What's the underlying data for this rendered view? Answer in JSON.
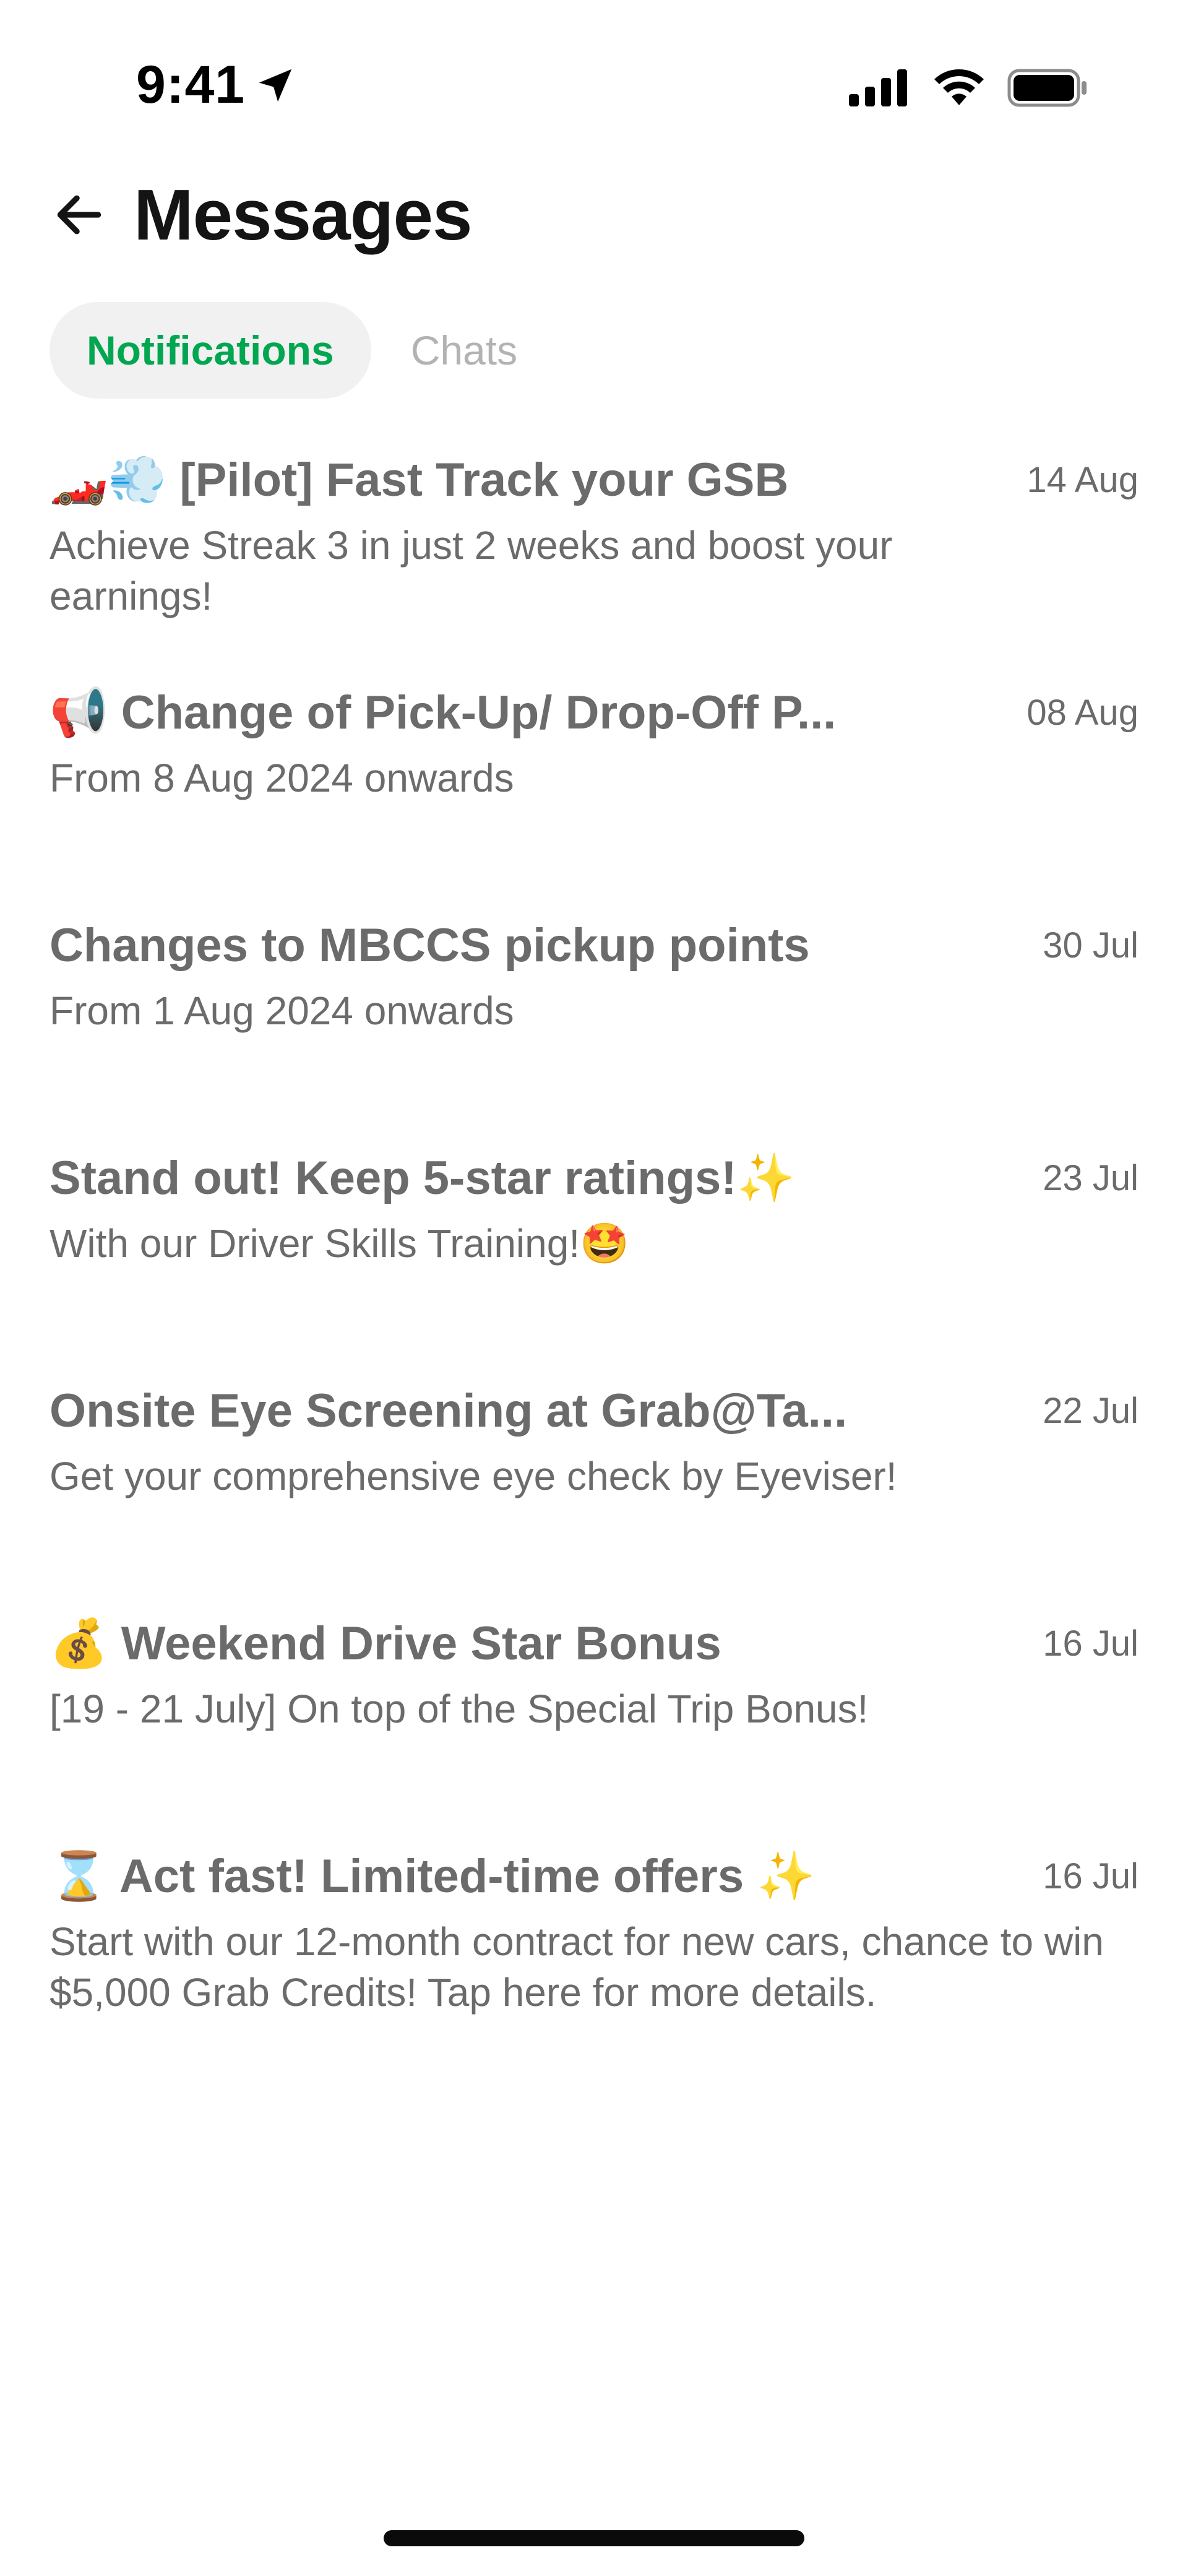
{
  "status_bar": {
    "time": "9:41"
  },
  "header": {
    "title": "Messages"
  },
  "tabs": [
    {
      "label": "Notifications",
      "active": true
    },
    {
      "label": "Chats",
      "active": false
    }
  ],
  "messages": [
    {
      "title": "🏎️💨 [Pilot] Fast Track your GSB",
      "date": "14 Aug",
      "subtitle": "Achieve Streak 3 in just 2 weeks and boost your earnings!"
    },
    {
      "title": "📢 Change of Pick-Up/ Drop-Off P...",
      "date": "08 Aug",
      "subtitle": "From 8 Aug 2024 onwards"
    },
    {
      "title": "Changes to MBCCS pickup points",
      "date": "30 Jul",
      "subtitle": "From 1 Aug 2024 onwards"
    },
    {
      "title": "Stand out! Keep 5-star ratings!✨",
      "date": "23 Jul",
      "subtitle": "With our Driver Skills Training!🤩"
    },
    {
      "title": "Onsite Eye Screening at Grab@Ta...",
      "date": "22 Jul",
      "subtitle": "Get your comprehensive eye check by Eyeviser!"
    },
    {
      "title": "💰 Weekend Drive Star Bonus",
      "date": "16 Jul",
      "subtitle": "[19 - 21 July] On top of the Special Trip Bonus!"
    },
    {
      "title": "⌛ Act fast! Limited-time offers ✨",
      "date": "16 Jul",
      "subtitle": "Start with our 12-month contract for new cars, chance to win $5,000 Grab Credits! Tap here for more details."
    }
  ],
  "colors": {
    "accent": "#00a650",
    "text_muted": "#6b6b6b",
    "tab_bg": "#f1f1f1"
  }
}
